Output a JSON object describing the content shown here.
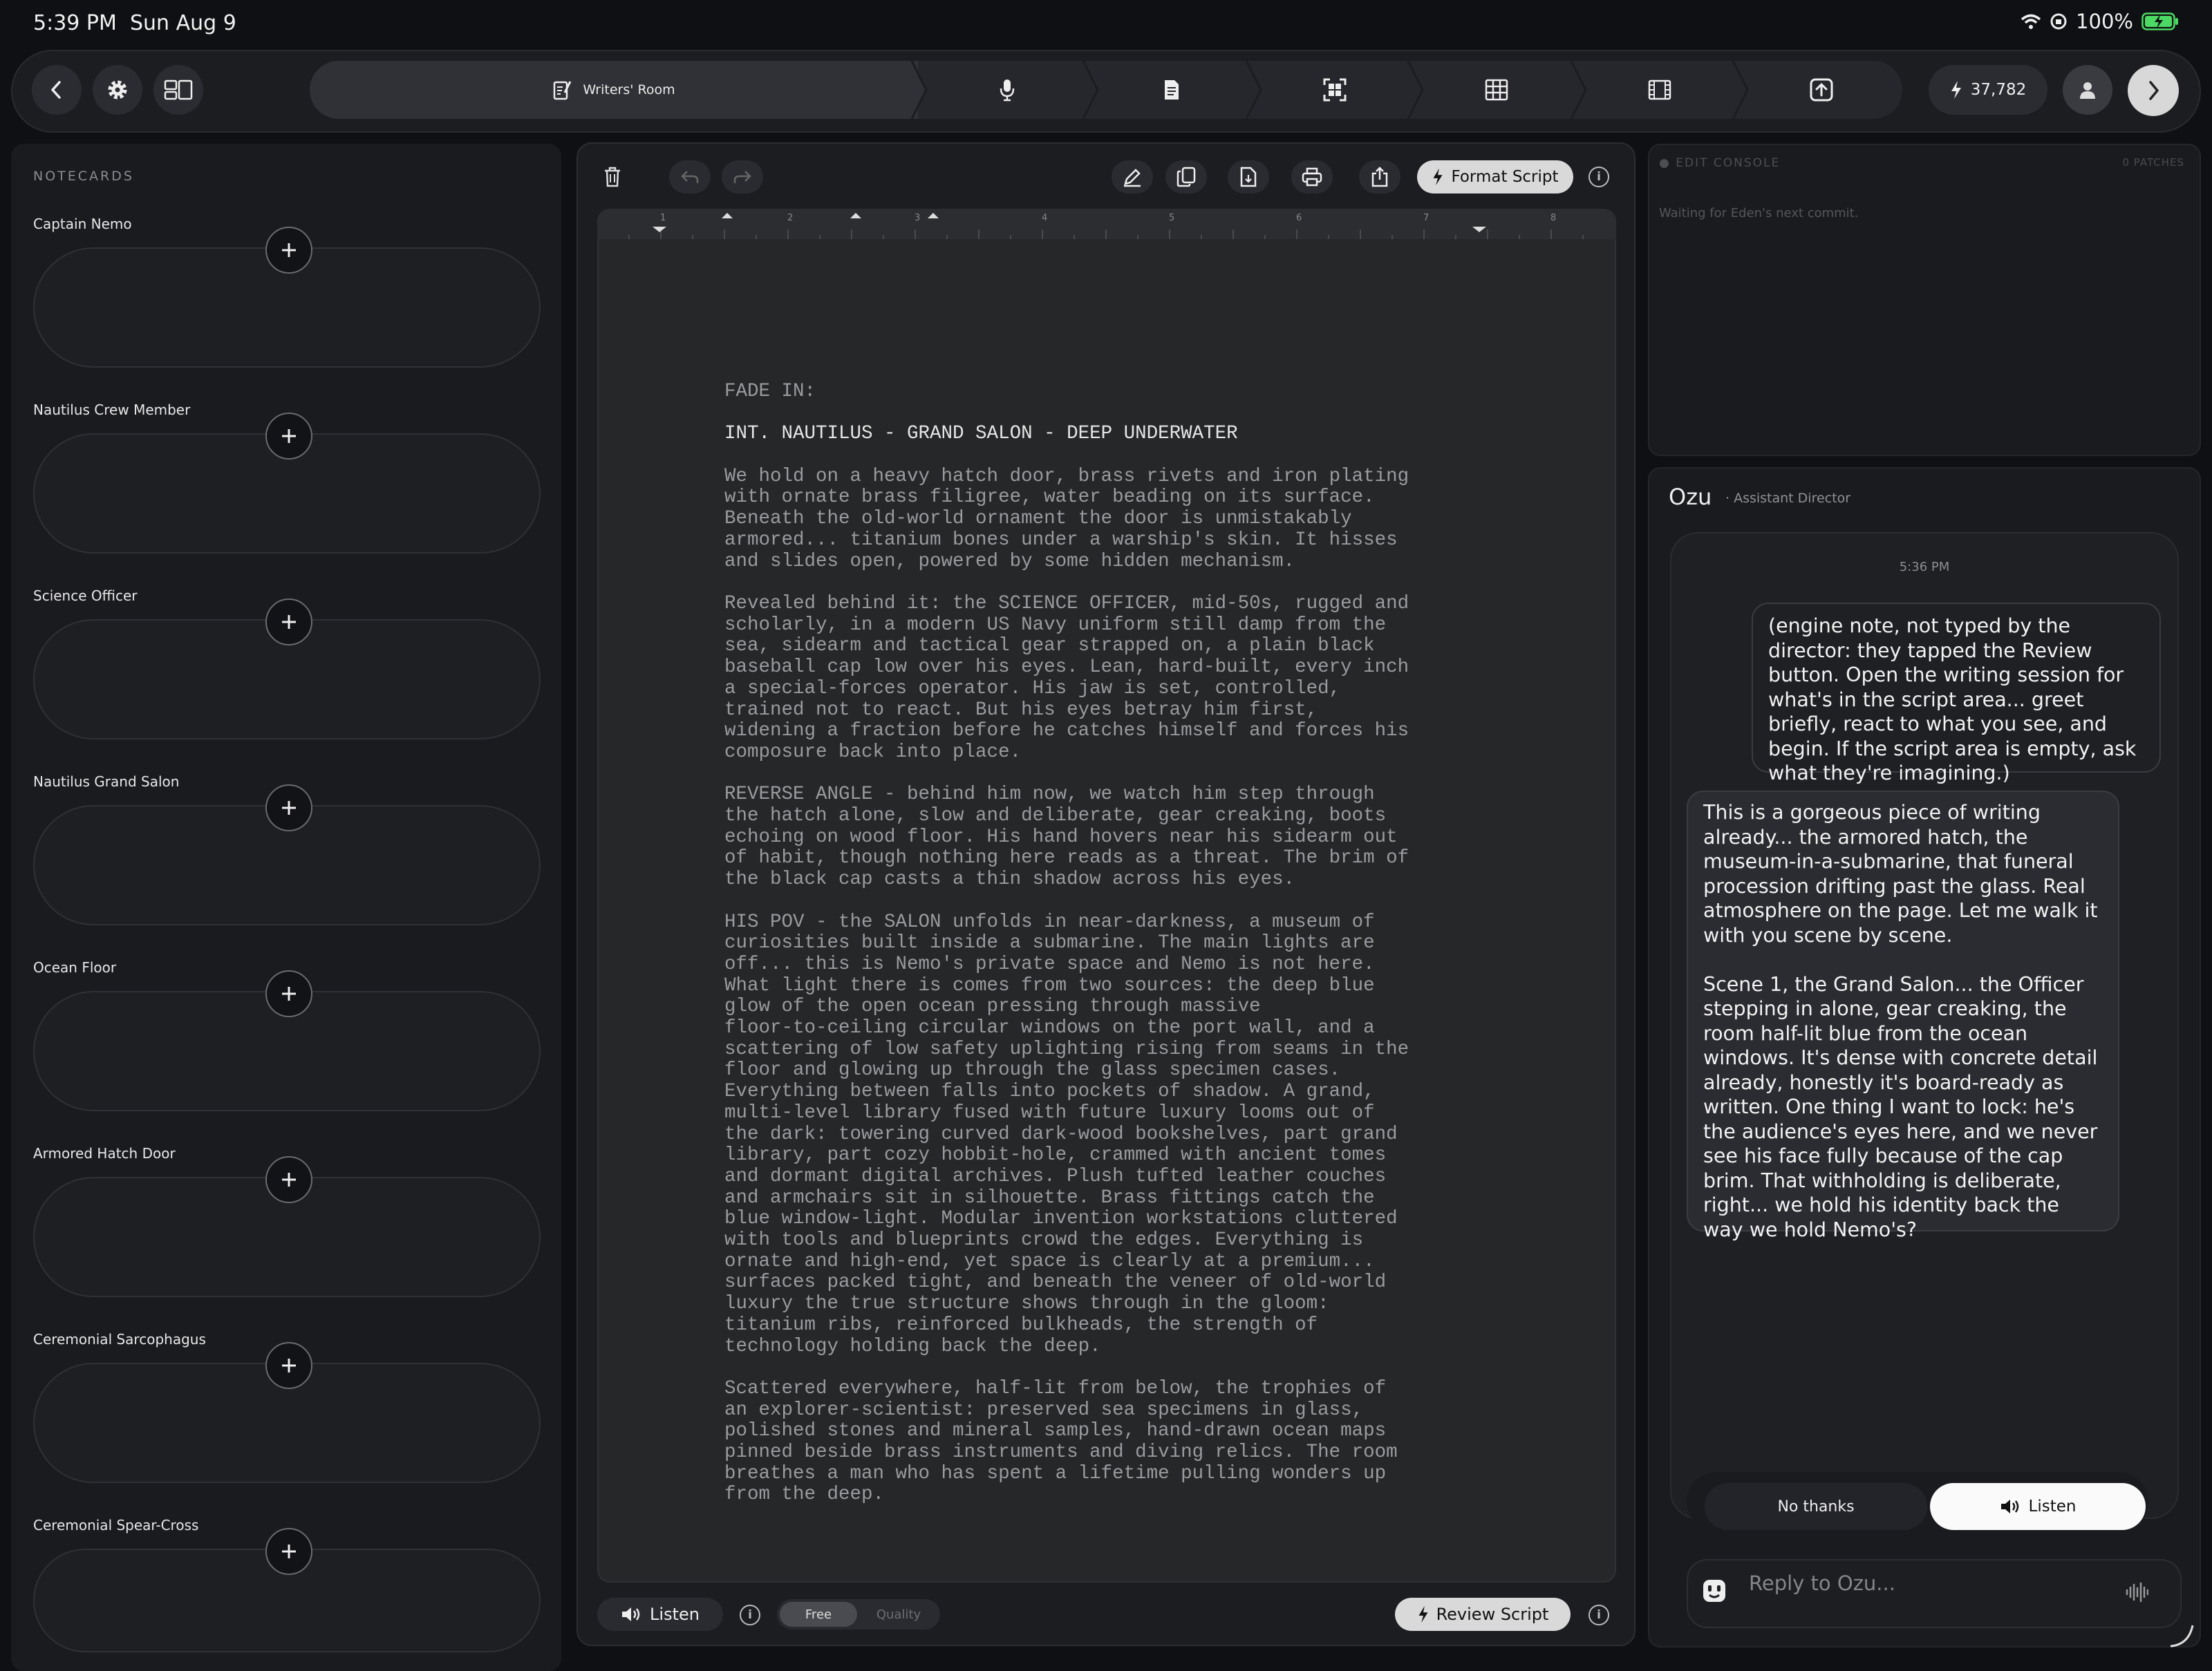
{
  "status_bar": {
    "time": "5:39 PM",
    "date": "Sun Aug 9",
    "battery": "100%"
  },
  "toolbar": {
    "pipeline": [
      {
        "label": "Writers' Room",
        "icon": "notepad-pencil-icon",
        "active": true
      },
      {
        "label": "",
        "icon": "microphone-icon"
      },
      {
        "label": "",
        "icon": "document-icon"
      },
      {
        "label": "",
        "icon": "storyboard-icon"
      },
      {
        "label": "",
        "icon": "table-grid-icon"
      },
      {
        "label": "",
        "icon": "film-strip-icon"
      },
      {
        "label": "",
        "icon": "export-upload-icon"
      }
    ],
    "tokens": "37,782"
  },
  "notecards": {
    "title": "NOTECARDS",
    "items": [
      {
        "label": "Captain Nemo"
      },
      {
        "label": "Nautilus Crew Member"
      },
      {
        "label": "Science Officer"
      },
      {
        "label": "Nautilus Grand Salon"
      },
      {
        "label": "Ocean Floor"
      },
      {
        "label": "Armored Hatch Door"
      },
      {
        "label": "Ceremonial Sarcophagus"
      },
      {
        "label": "Ceremonial Spear-Cross"
      }
    ]
  },
  "editor": {
    "format_label": "Format Script",
    "ruler_numbers": [
      "1",
      "2",
      "3",
      "4",
      "5",
      "6",
      "7",
      "8"
    ],
    "script": {
      "fade_in": "FADE IN:",
      "heading": "INT. NAUTILUS - GRAND SALON - DEEP UNDERWATER",
      "p1": "We hold on a heavy hatch door, brass rivets and iron plating\nwith ornate brass filigree, water beading on its surface.\nBeneath the old-world ornament the door is unmistakably\narmored... titanium bones under a warship's skin. It hisses\nand slides open, powered by some hidden mechanism.",
      "p2": "Revealed behind it: the SCIENCE OFFICER, mid-50s, rugged and\nscholarly, in a modern US Navy uniform still damp from the\nsea, sidearm and tactical gear strapped on, a plain black\nbaseball cap low over his eyes. Lean, hard-built, every inch\na special-forces operator. His jaw is set, controlled,\ntrained not to react. But his eyes betray him first,\nwidening a fraction before he catches himself and forces his\ncomposure back into place.",
      "p3": "REVERSE ANGLE - behind him now, we watch him step through\nthe hatch alone, slow and deliberate, gear creaking, boots\nechoing on wood floor. His hand hovers near his sidearm out\nof habit, though nothing here reads as a threat. The brim of\nthe black cap casts a thin shadow across his eyes.",
      "p4": "HIS POV - the SALON unfolds in near-darkness, a museum of\ncuriosities built inside a submarine. The main lights are\noff... this is Nemo's private space and Nemo is not here.\nWhat light there is comes from two sources: the deep blue\nglow of the open ocean pressing through massive\nfloor-to-ceiling circular windows on the port wall, and a\nscattering of low safety uplighting rising from seams in the\nfloor and glowing up through the glass specimen cases.\nEverything between falls into pockets of shadow. A grand,\nmulti-level library fused with future luxury looms out of\nthe dark: towering curved dark-wood bookshelves, part grand\nlibrary, part cozy hobbit-hole, crammed with ancient tomes\nand dormant digital archives. Plush tufted leather couches\nand armchairs sit in silhouette. Brass fittings catch the\nblue window-light. Modular invention workstations cluttered\nwith tools and blueprints crowd the edges. Everything is\nornate and high-end, yet space is clearly at a premium...\nsurfaces packed tight, and beneath the veneer of old-world\nluxury the true structure shows through in the gloom:\ntitanium ribs, reinforced bulkheads, the strength of\ntechnology holding back the deep.",
      "p5": "Scattered everywhere, half-lit from below, the trophies of\nan explorer-scientist: preserved sea specimens in glass,\npolished stones and mineral samples, hand-drawn ocean maps\npinned beside brass instruments and diving relics. The room\nbreathes a man who has spent a lifetime pulling wonders up\nfrom the deep."
    },
    "listen_label": "Listen",
    "quality_options": [
      "Free",
      "Quality"
    ],
    "quality_selected": "Free",
    "review_label": "Review Script"
  },
  "edit_console": {
    "title": "EDIT CONSOLE",
    "patches": "0 PATCHES",
    "waiting": "Waiting for Eden's next commit."
  },
  "chat": {
    "assistant_name": "Ozu",
    "assistant_role": "· Assistant Director",
    "timestamp": "5:36 PM",
    "user_message": "(engine note, not typed by the director: they tapped the Review button. Open the writing session for what's in the script area... greet briefly, react to what you see, and begin. If the script area is empty, ask what they're imagining.)",
    "assistant_message": "This is a gorgeous piece of writing already... the armored hatch, the museum-in-a-submarine, that funeral procession drifting past the glass. Real atmosphere on the page. Let me walk it with you scene by scene.\n\nScene 1, the Grand Salon... the Officer stepping in alone, gear creaking, the room half-lit blue from the ocean windows. It's dense with concrete detail already, honestly it's board-ready as written. One thing I want to lock: he's the audience's eyes here, and we never see his face fully because of the cap brim. That withholding is deliberate, right... we hold his identity back the way we hold Nemo's?",
    "no_thanks_label": "No thanks",
    "listen_label": "Listen",
    "reply_placeholder": "Reply to Ozu..."
  }
}
